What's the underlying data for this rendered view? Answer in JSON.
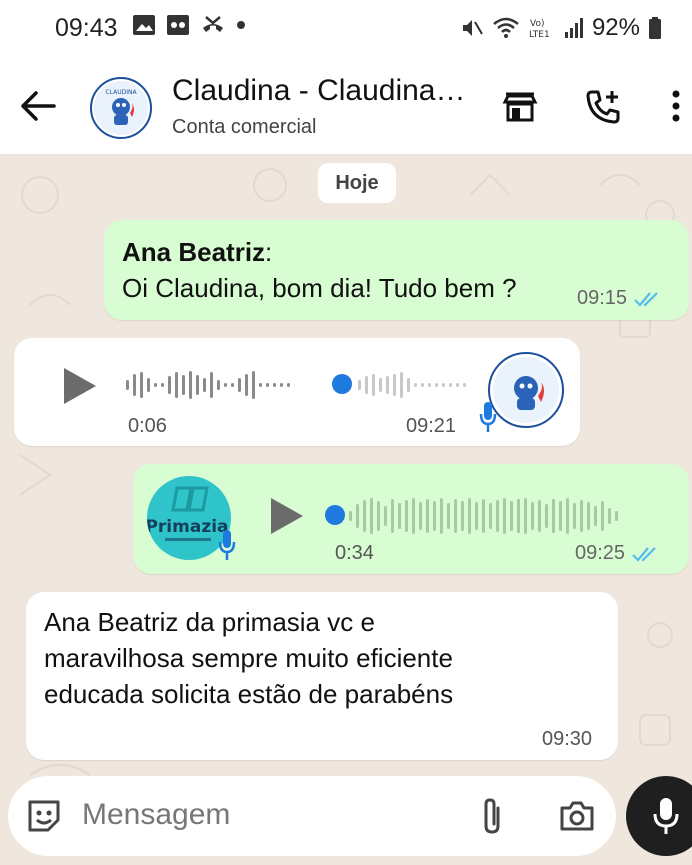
{
  "status_bar": {
    "time": "09:43",
    "battery": "92%",
    "icons": [
      "image-icon",
      "voicemail-icon",
      "missed-call-icon",
      "dot-icon",
      "mute-icon",
      "wifi-icon",
      "volte-icon",
      "signal-icon",
      "battery-icon"
    ]
  },
  "header": {
    "title": "Claudina - Claudina…",
    "subtitle": "Conta comercial",
    "avatar_text": "CLAUDINA",
    "icons": [
      "back-arrow-icon",
      "store-icon",
      "add-call-icon",
      "more-vert-icon"
    ]
  },
  "chat": {
    "date_chip": "Hoje",
    "messages": [
      {
        "type": "text",
        "direction": "out",
        "sender": "Ana Beatriz",
        "sender_suffix": ":",
        "text": "Oi Claudina, bom dia! Tudo bem ?",
        "time": "09:15",
        "status": "read"
      },
      {
        "type": "audio",
        "direction": "in",
        "duration": "0:06",
        "time": "09:21",
        "progress": 0.62
      },
      {
        "type": "audio",
        "direction": "out",
        "avatar_text": "Primazia",
        "duration": "0:34",
        "time": "09:25",
        "status": "read",
        "progress": 0.0
      },
      {
        "type": "text",
        "direction": "in",
        "text_lines": [
          "Ana Beatriz  da primasia  vc e",
          "maravilhosa sempre muito eficiente",
          "educada solicita estão  de parabéns"
        ],
        "time": "09:30"
      }
    ]
  },
  "composer": {
    "placeholder": "Mensagem",
    "icons": [
      "emoji-icon",
      "attach-icon",
      "camera-icon",
      "mic-icon"
    ]
  },
  "colors": {
    "outgoing_bubble": "#d9fdd3",
    "incoming_bubble": "#ffffff",
    "read_ticks": "#53bdeb",
    "audio_dot": "#1f7ae0"
  }
}
